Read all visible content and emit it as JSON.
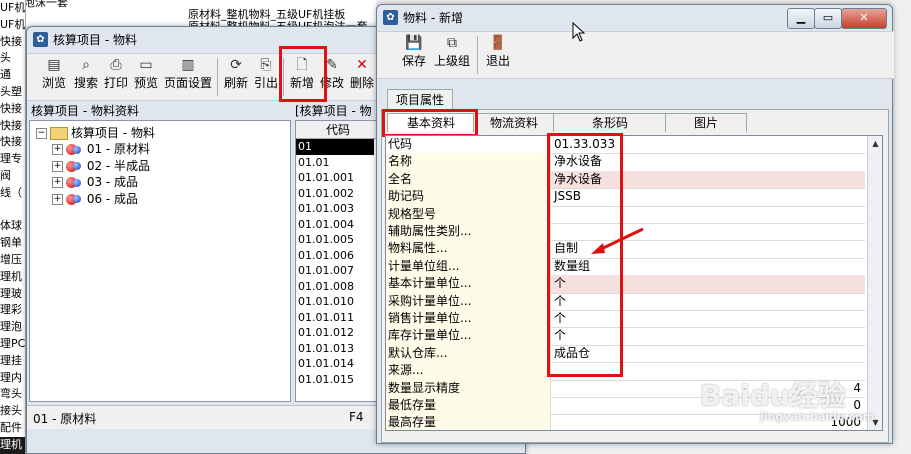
{
  "background": {
    "top_lines": [
      "IJF机泡沫一套",
      "原材料_整机物料_五级UF机挂板",
      "原材料_整机物料_五级UF机泡沫一套",
      "原材料_整机物料_五级UF机挂板"
    ],
    "left_fragments": [
      "UF机泡沫一套",
      "UF机挂板",
      "快接",
      "头",
      "通",
      "头塑",
      "快接",
      "快接",
      "快接",
      "理专",
      "阀",
      "线（",
      "",
      "体球",
      "钢单",
      "增压",
      "理机",
      "理玻",
      "理彩",
      "理泡",
      "理PC",
      "理挂",
      "理内",
      "弯头",
      "接头",
      "配件",
      "理机"
    ]
  },
  "left_window": {
    "title": "核算项目 - 物料",
    "toolbar": {
      "browse": "浏览",
      "search": "搜索",
      "print": "打印",
      "preview": "预览",
      "page_setup": "页面设置",
      "refresh": "刷新",
      "import": "引出",
      "new": "新增",
      "modify": "修改",
      "delete": "删除"
    },
    "tree_header": "核算项目 - 物料资料",
    "list_header_partial": "[核算项目 - 物",
    "tree": {
      "root": "核算项目 - 物料",
      "items": [
        "01 - 原材料",
        "02 - 半成品",
        "03 - 成品",
        "06 - 成品"
      ]
    },
    "code_column_header": "代码",
    "codes": [
      "01",
      "01.01",
      "01.01.001",
      "01.01.002",
      "01.01.003",
      "01.01.004",
      "01.01.005",
      "01.01.006",
      "01.01.007",
      "01.01.008",
      "01.01.010",
      "01.01.011",
      "01.01.012",
      "01.01.013",
      "01.01.014",
      "01.01.015"
    ],
    "status_left": "01 - 原材料",
    "status_right": "F4"
  },
  "right_window": {
    "title": "物料 - 新增",
    "toolbar": {
      "save": "保存",
      "parent": "上级组",
      "exit": "退出"
    },
    "outer_tab": "项目属性",
    "tabs": [
      "基本资料",
      "物流资料",
      "条形码",
      "图片"
    ],
    "properties": [
      {
        "label": "代码",
        "value": "01.33.033",
        "required": false,
        "num": false
      },
      {
        "label": "名称",
        "value": "净水设备",
        "required": false,
        "num": false
      },
      {
        "label": "全名",
        "value": "净水设备",
        "required": true,
        "num": false
      },
      {
        "label": "助记码",
        "value": "JSSB",
        "required": false,
        "num": false
      },
      {
        "label": "规格型号",
        "value": "",
        "required": false,
        "num": false
      },
      {
        "label": "辅助属性类别...",
        "value": "",
        "required": false,
        "num": false
      },
      {
        "label": "物料属性...",
        "value": "自制",
        "required": false,
        "num": false
      },
      {
        "label": "计量单位组...",
        "value": "数量组",
        "required": false,
        "num": false
      },
      {
        "label": "基本计量单位...",
        "value": "个",
        "required": true,
        "num": false
      },
      {
        "label": "采购计量单位...",
        "value": "个",
        "required": false,
        "num": false
      },
      {
        "label": "销售计量单位...",
        "value": "个",
        "required": false,
        "num": false
      },
      {
        "label": "库存计量单位...",
        "value": "个",
        "required": false,
        "num": false
      },
      {
        "label": "默认仓库...",
        "value": "成品仓",
        "required": false,
        "num": false
      },
      {
        "label": "来源...",
        "value": "",
        "required": false,
        "num": false
      },
      {
        "label": "数量显示精度",
        "value": "4",
        "required": false,
        "num": true
      },
      {
        "label": "最低存量",
        "value": "0",
        "required": false,
        "num": true
      },
      {
        "label": "最高存量",
        "value": "1000",
        "required": false,
        "num": true
      }
    ]
  },
  "watermark": {
    "brand": "Baidu经验",
    "url": "jingyan.baidu.com"
  },
  "colors": {
    "highlight": "#e01010",
    "required_bg": "#f6e0e0",
    "label_bg": "#fffbe9"
  }
}
